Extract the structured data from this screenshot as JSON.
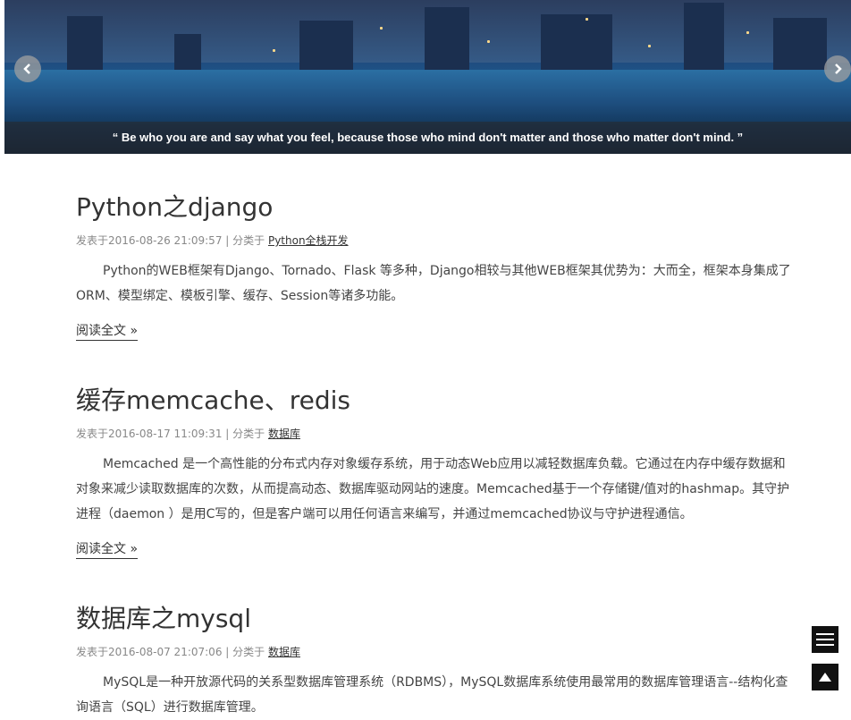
{
  "banner": {
    "prev_icon": "chevron-left-icon",
    "next_icon": "chevron-right-icon",
    "caption": "“ Be who you are and say what you feel, because those who mind don't matter and those who matter don't mind. ”"
  },
  "posts": [
    {
      "title": "Python之django",
      "meta_prefix": "发表于2016-08-26 21:09:57 | 分类于",
      "category": "Python全栈开发",
      "excerpt": "Python的WEB框架有Django、Tornado、Flask 等多种，Django相较与其他WEB框架其优势为：大而全，框架本身集成了ORM、模型绑定、模板引擎、缓存、Session等诸多功能。",
      "read_more": "阅读全文 »"
    },
    {
      "title": "缓存memcache、redis",
      "meta_prefix": "发表于2016-08-17 11:09:31 | 分类于",
      "category": "数据库",
      "excerpt": "Memcached  是一个高性能的分布式内存对象缓存系统，用于动态Web应用以减轻数据库负载。它通过在内存中缓存数据和对象来减少读取数据库的次数，从而提高动态、数据库驱动网站的速度。Memcached基于一个存储键/值对的hashmap。其守护进程（daemon ）是用C写的，但是客户端可以用任何语言来编写，并通过memcached协议与守护进程通信。",
      "read_more": "阅读全文 »"
    },
    {
      "title": "数据库之mysql",
      "meta_prefix": "发表于2016-08-07 21:07:06 | 分类于",
      "category": "数据库",
      "excerpt": "MySQL是一种开放源代码的关系型数据库管理系统（RDBMS），MySQL数据库系统使用最常用的数据库管理语言--结构化查询语言（SQL）进行数据库管理。"
    }
  ],
  "fixed_buttons": {
    "menu_icon": "menu-icon",
    "top_icon": "back-to-top-icon"
  }
}
